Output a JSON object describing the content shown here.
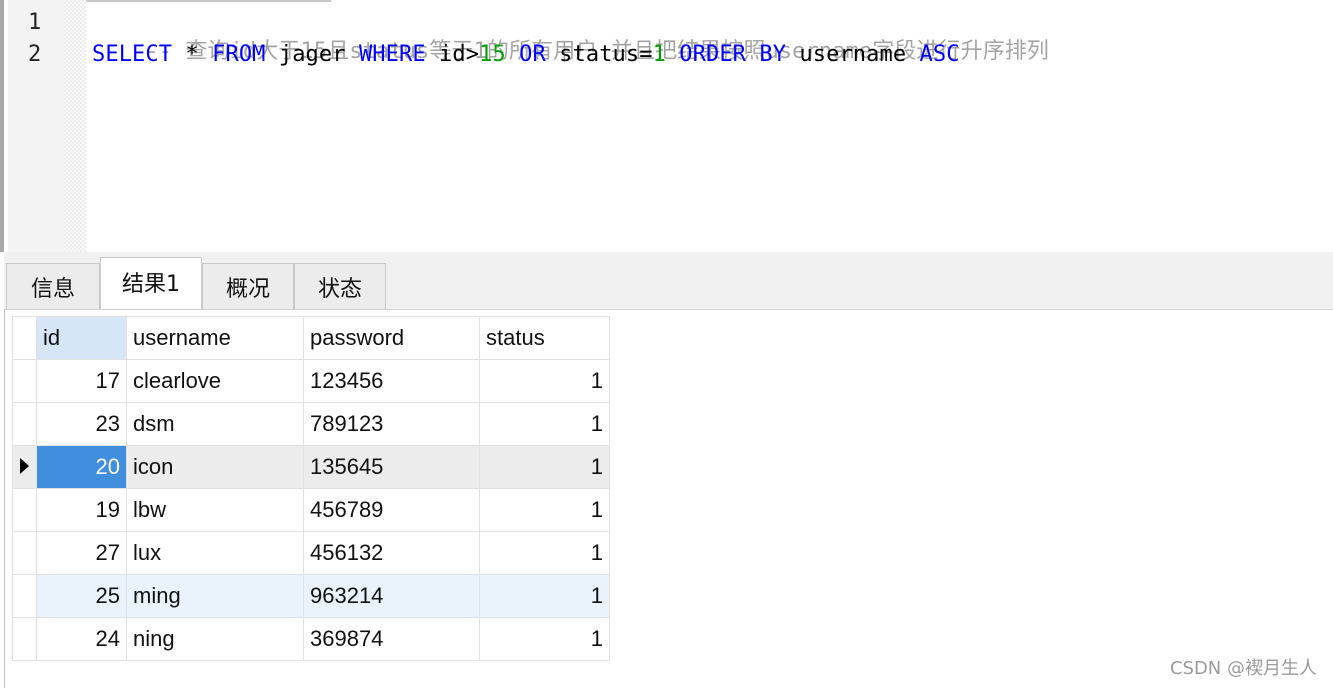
{
  "editor": {
    "line_numbers": [
      "1",
      "2"
    ],
    "line1_comment": "-- 查询id大于15且status等于1的所有用户 并且把结果按照username字段进行升序排列",
    "line2_tokens": {
      "select": "SELECT",
      "star": " * ",
      "from": "FROM",
      "table": " jager ",
      "where": "WHERE",
      "cond1_field": " id>",
      "cond1_value": "15",
      "or": " OR",
      "cond2_field": " status=",
      "cond2_value": "1",
      "order": " ORDER",
      "by": " BY",
      "order_field": " username ",
      "asc": "ASC"
    }
  },
  "tabs": [
    {
      "label": "信息",
      "active": false
    },
    {
      "label": "结果1",
      "active": true
    },
    {
      "label": "概况",
      "active": false
    },
    {
      "label": "状态",
      "active": false
    }
  ],
  "grid": {
    "columns": [
      "id",
      "username",
      "password",
      "status"
    ],
    "rows": [
      {
        "id": "17",
        "username": "clearlove",
        "password": "123456",
        "status": "1"
      },
      {
        "id": "23",
        "username": "dsm",
        "password": "789123",
        "status": "1"
      },
      {
        "id": "20",
        "username": "icon",
        "password": "135645",
        "status": "1"
      },
      {
        "id": "19",
        "username": "lbw",
        "password": "456789",
        "status": "1"
      },
      {
        "id": "27",
        "username": "lux",
        "password": "456132",
        "status": "1"
      },
      {
        "id": "25",
        "username": "ming",
        "password": "963214",
        "status": "1"
      },
      {
        "id": "24",
        "username": "ning",
        "password": "369874",
        "status": "1"
      }
    ],
    "current_row_index": 2,
    "hover_row_index": 5,
    "current_row_icon": "row-pointer-icon"
  },
  "watermark": "CSDN @褉月生人",
  "colors": {
    "keyword": "#0000ff",
    "comment": "#a4a4a4",
    "number": "#00a000",
    "selected_cell": "#3f8fde"
  }
}
